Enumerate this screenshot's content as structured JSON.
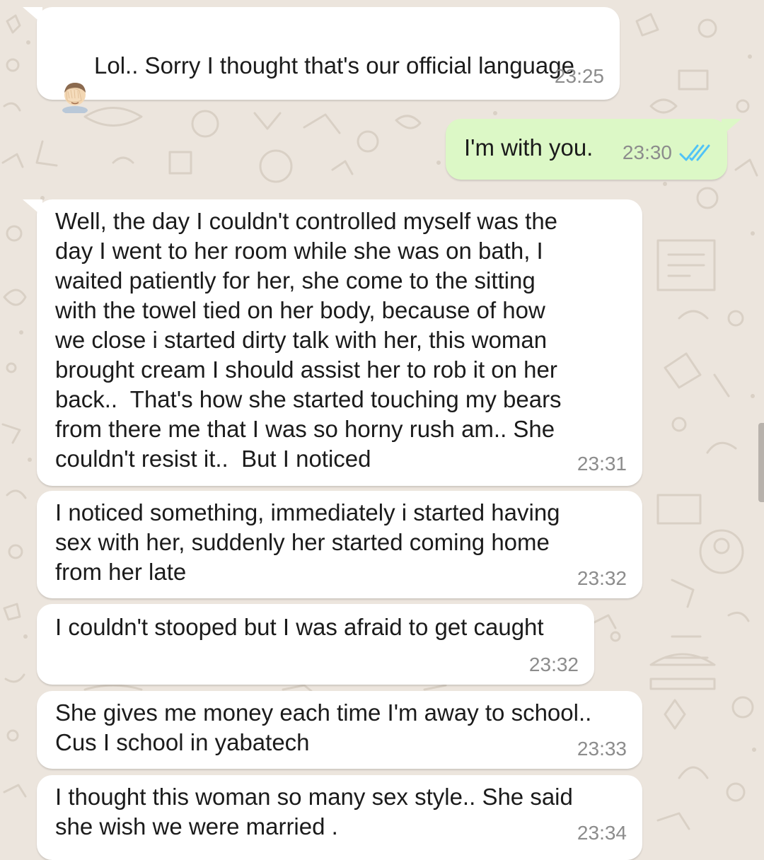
{
  "messages": [
    {
      "direction": "incoming",
      "text": "Lol.. Sorry I thought that's our official language",
      "emoji": "face-palm-emoji",
      "time": "23:25"
    },
    {
      "direction": "outgoing",
      "text": "I'm with you.",
      "time": "23:30",
      "status": "read",
      "status_icon": "double-check-icon",
      "status_color": "#4fc3f7"
    },
    {
      "direction": "incoming",
      "text": "Well, the day I couldn't controlled myself was the\nday I went to her room while she was on bath, I\nwaited patiently for her, she come to the sitting\nwith the towel tied on her body, because of how\nwe close i started dirty talk with her, this woman\nbrought cream I should assist her to rob it on her\nback..  That's how she started touching my bears\nfrom there me that I was so horny rush am.. She\ncouldn't resist it..  But I noticed",
      "time": "23:31"
    },
    {
      "direction": "incoming",
      "text": "I noticed something, immediately i started having\nsex with her, suddenly her started coming home\nfrom her late",
      "time": "23:32"
    },
    {
      "direction": "incoming",
      "text": "I couldn't stooped but I was afraid to get caught",
      "time": "23:32"
    },
    {
      "direction": "incoming",
      "text": "She gives me money each time I'm away to school..\nCus I school in yabatech",
      "time": "23:33"
    },
    {
      "direction": "incoming",
      "text": "I thought this woman so many sex style.. She said\nshe wish we were married .",
      "time": "23:34"
    }
  ],
  "colors": {
    "wallpaper": "#ece5dd",
    "incoming_bubble": "#ffffff",
    "outgoing_bubble": "#dcf8c6",
    "timestamp": "#8c8c8c",
    "read_ticks": "#4fc3f7"
  }
}
